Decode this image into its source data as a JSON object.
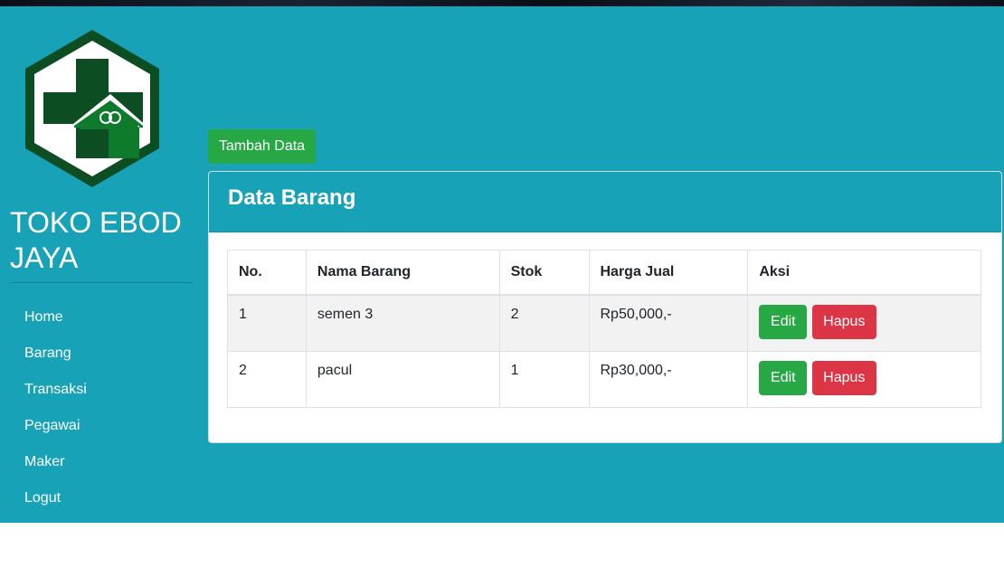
{
  "colors": {
    "primary_bg": "#17a2b8",
    "success": "#28a745",
    "danger": "#dc3545",
    "logo_dark_green": "#0d4d22",
    "logo_green": "#0e7a2c"
  },
  "sidebar": {
    "logo_icon": "hexagon-cross-house-logo",
    "brand": "TOKO EBOD JAYA",
    "items": [
      {
        "label": "Home"
      },
      {
        "label": "Barang"
      },
      {
        "label": "Transaksi"
      },
      {
        "label": "Pegawai"
      },
      {
        "label": "Maker"
      },
      {
        "label": "Logut"
      }
    ]
  },
  "main": {
    "add_button": "Tambah Data",
    "card_title": "Data Barang",
    "table": {
      "headers": [
        "No.",
        "Nama Barang",
        "Stok",
        "Harga Jual",
        "Aksi"
      ],
      "rows": [
        {
          "no": "1",
          "nama": "semen 3",
          "stok": "2",
          "harga": "Rp50,000,-",
          "edit": "Edit",
          "hapus": "Hapus"
        },
        {
          "no": "2",
          "nama": "pacul",
          "stok": "1",
          "harga": "Rp30,000,-",
          "edit": "Edit",
          "hapus": "Hapus"
        }
      ]
    }
  }
}
